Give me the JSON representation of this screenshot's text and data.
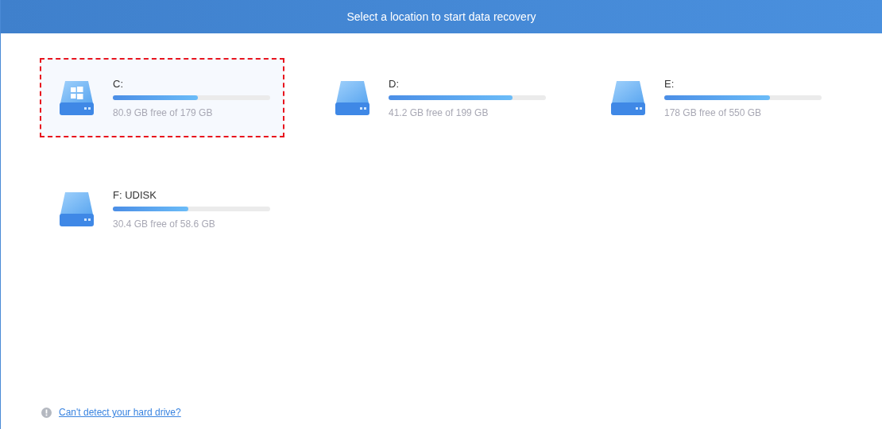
{
  "header": {
    "title": "Select a location to start data recovery"
  },
  "drives": [
    {
      "kind": "system",
      "label": "C:",
      "level": 0.54,
      "capacity": "80.9 GB free of 179 GB",
      "selected": true
    },
    {
      "kind": "plain",
      "label": "D:",
      "level": 0.79,
      "capacity": "41.2 GB free of 199 GB",
      "selected": false
    },
    {
      "kind": "plain",
      "label": "E:",
      "level": 0.67,
      "capacity": "178 GB free of 550 GB",
      "selected": false
    },
    {
      "kind": "plain",
      "label": "F: UDISK",
      "level": 0.48,
      "capacity": "30.4 GB free of 58.6 GB",
      "selected": false
    }
  ],
  "help_link": "Can't detect your hard drive?"
}
